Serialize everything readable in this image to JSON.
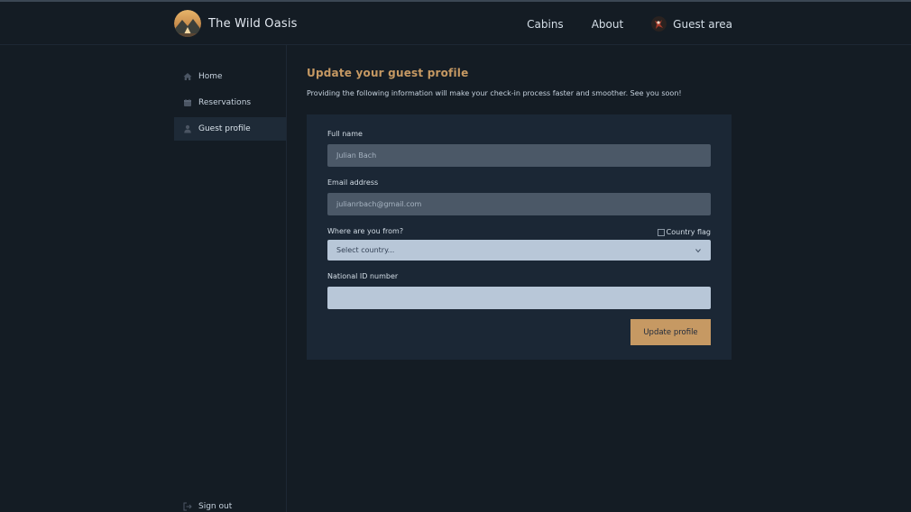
{
  "brand": {
    "name": "The Wild Oasis"
  },
  "nav": {
    "cabins": "Cabins",
    "about": "About",
    "guest_area": "Guest area"
  },
  "sidebar": {
    "items": [
      {
        "label": "Home",
        "icon": "home-icon"
      },
      {
        "label": "Reservations",
        "icon": "calendar-icon"
      },
      {
        "label": "Guest profile",
        "icon": "user-icon",
        "active": true
      }
    ],
    "sign_out": "Sign out"
  },
  "page": {
    "title": "Update your guest profile",
    "subtitle": "Providing the following information will make your check-in process faster and smoother. See you soon!"
  },
  "form": {
    "full_name_label": "Full name",
    "full_name_value": "Julian Bach",
    "email_label": "Email address",
    "email_value": "julianrbach@gmail.com",
    "country_label": "Where are you from?",
    "country_flag_alt": "Country flag",
    "country_value": "Select country...",
    "national_id_label": "National ID number",
    "national_id_value": "",
    "submit_label": "Update profile"
  },
  "colors": {
    "accent": "#c69963",
    "background": "#141c24",
    "card": "#1b2735"
  }
}
